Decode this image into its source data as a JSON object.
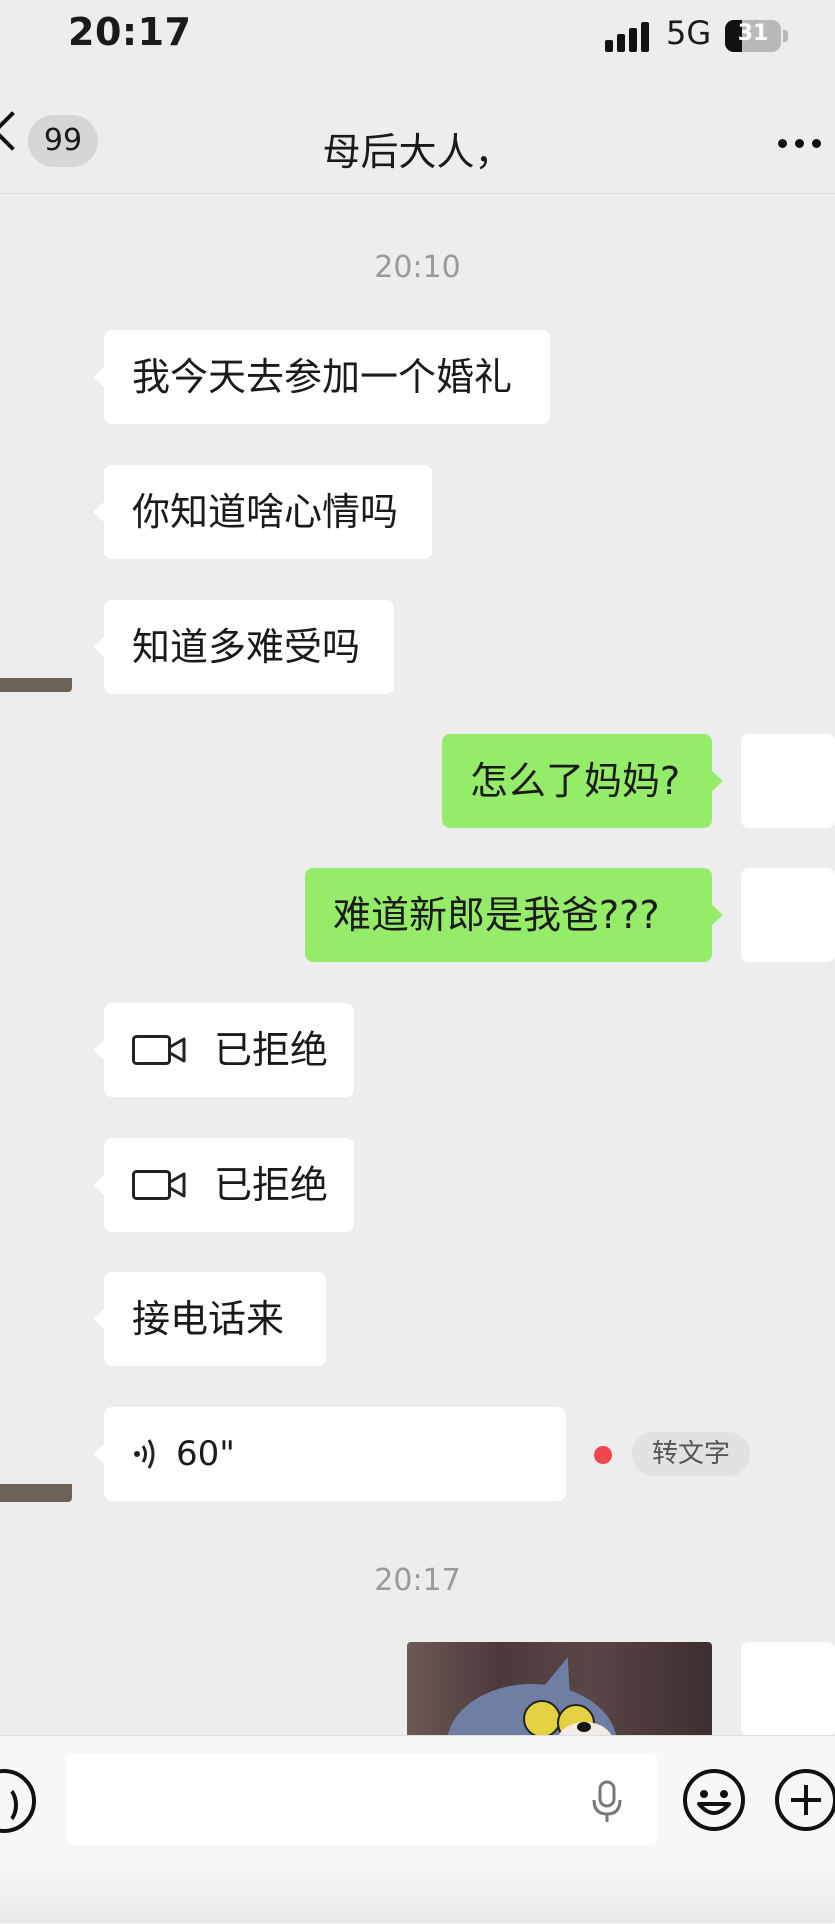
{
  "status_bar": {
    "time": "20:17",
    "network": "5G",
    "battery": "31",
    "battery_level": 0.31
  },
  "header": {
    "unread_count": "99",
    "title": "母后大人，"
  },
  "chat": {
    "timestamp_1": "20:10",
    "messages": [
      {
        "text": "我今天去参加一个婚礼"
      },
      {
        "text": "你知道啥心情吗"
      },
      {
        "text": "知道多难受吗"
      },
      {
        "text": "怎么了妈妈?"
      },
      {
        "text": "难道新郎是我爸???"
      },
      {
        "text": "已拒绝",
        "icon": "video-call-icon"
      },
      {
        "text": "已拒绝",
        "icon": "video-call-icon"
      },
      {
        "text": "接电话来"
      }
    ],
    "voice_message": {
      "duration": "60\"",
      "transcribe_label": "转文字"
    },
    "timestamp_2": "20:17"
  },
  "input_bar": {
    "placeholder": ""
  },
  "colors": {
    "incoming": "#ffffff",
    "outgoing": "#95ec69",
    "background": "#ededed",
    "unread_dot": "#f2464f"
  }
}
